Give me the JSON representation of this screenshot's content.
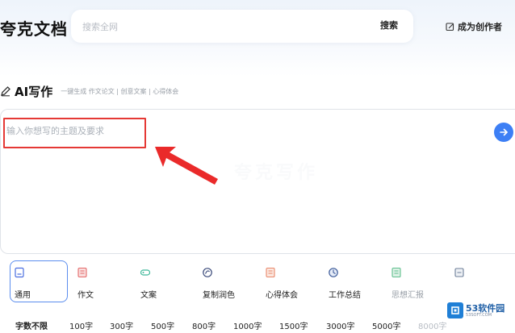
{
  "header": {
    "brand": "夸克文档",
    "search_placeholder": "搜索全网",
    "search_button": "搜索",
    "creator_label": "成为创作者"
  },
  "ai_section": {
    "title": "AI写作",
    "subtitle": "一键生成 作文论文 | 创意文案 | 心得体会"
  },
  "editor": {
    "placeholder": "输入你想写的主题及要求",
    "watermark": "夸克写作"
  },
  "writing_types": [
    {
      "label": "通用",
      "icon": "doc-icon",
      "active": true
    },
    {
      "label": "作文",
      "icon": "essay-icon"
    },
    {
      "label": "文案",
      "icon": "copywriting-icon"
    },
    {
      "label": "复制润色",
      "icon": "polish-icon"
    },
    {
      "label": "心得体会",
      "icon": "reflection-icon"
    },
    {
      "label": "工作总结",
      "icon": "summary-icon"
    },
    {
      "label": "思想汇报",
      "icon": "report-icon"
    },
    {
      "label": "",
      "icon": "more-icon"
    }
  ],
  "word_counts": [
    "字数不限",
    "100字",
    "300字",
    "500字",
    "800字",
    "1000字",
    "1500字",
    "3000字",
    "5000字",
    "8000字"
  ],
  "site_badge": {
    "name": "53软件园",
    "sub": "53SOFT.COM"
  },
  "colors": {
    "accent": "#3d7ff5",
    "highlight_red": "#e53935",
    "active_border": "#5b8dee"
  }
}
